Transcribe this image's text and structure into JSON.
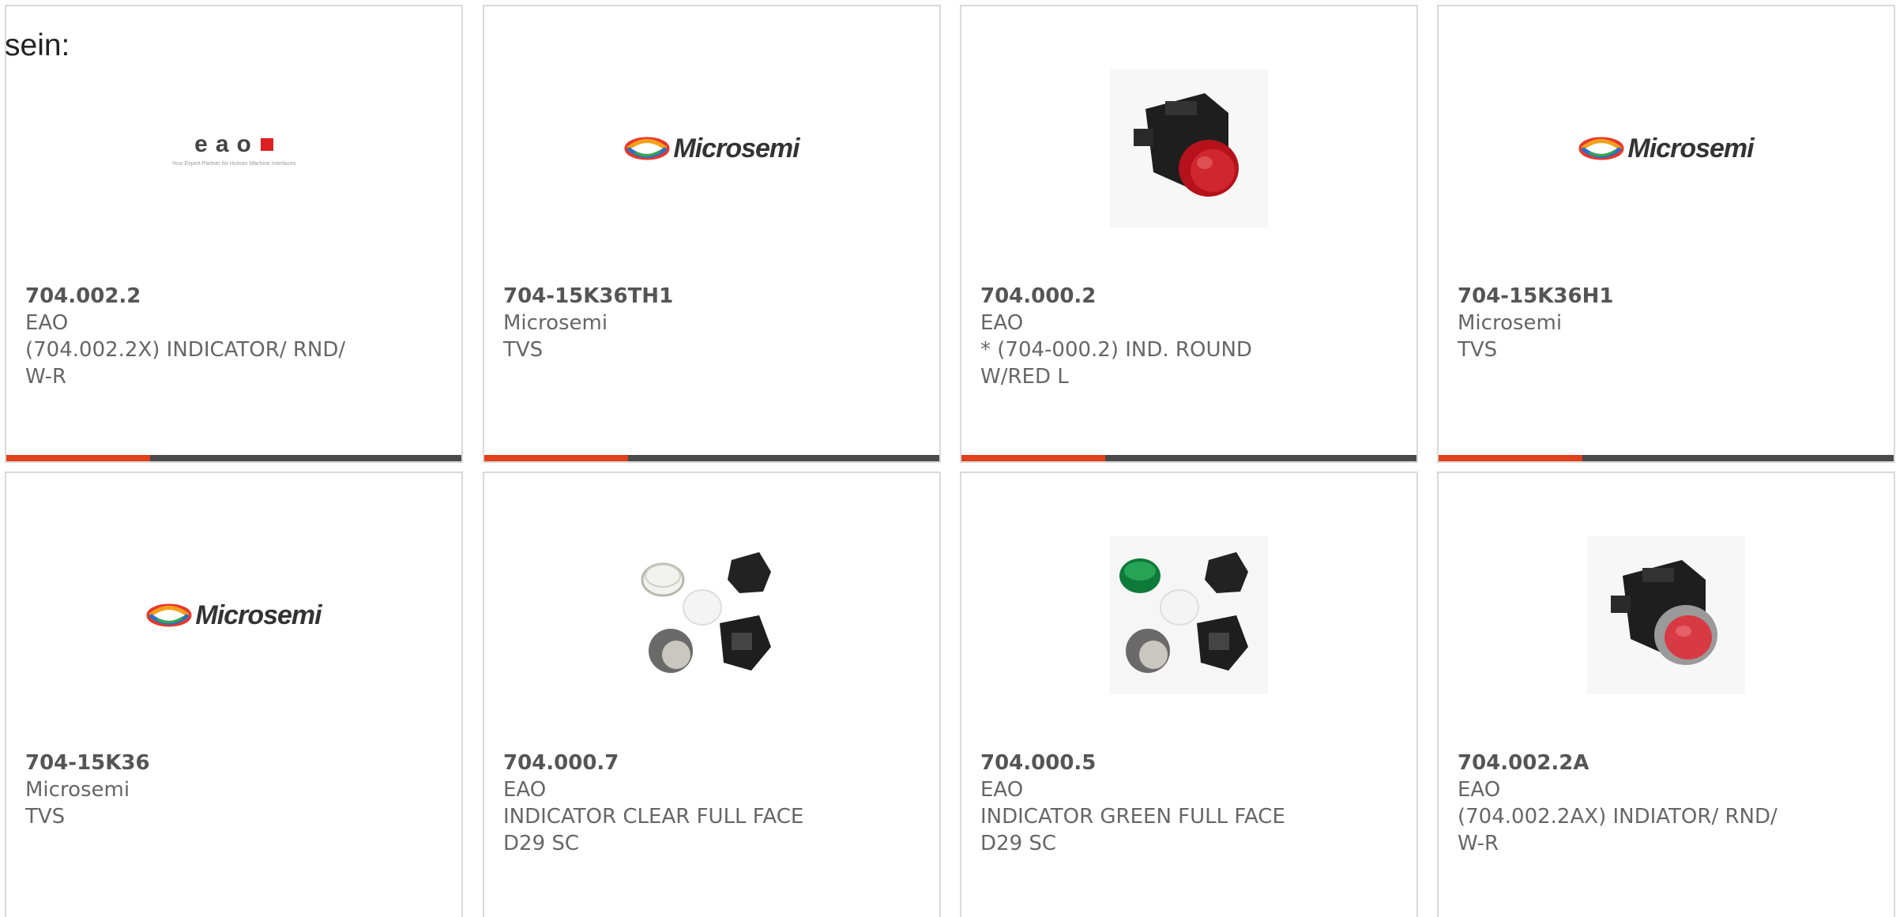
{
  "intro_text": "sein:",
  "brand_colors": {
    "accent": "#e0401a",
    "bar": "#4a4a4a",
    "border": "#d9d9d9"
  },
  "cards": [
    {
      "image": "eao-logo",
      "logo_word": "eao",
      "logo_tagline": "Your Expert Partner for Human Machine Interfaces",
      "part": "704.002.2",
      "mfr": "EAO",
      "desc": "(704.002.2X) INDICATOR/ RND/ W-R"
    },
    {
      "image": "microsemi-logo",
      "logo_word": "Microsemi",
      "part": "704-15K36TH1",
      "mfr": "Microsemi",
      "desc": "TVS"
    },
    {
      "image": "red-indicator-photo",
      "part": "704.000.2",
      "mfr": "EAO",
      "desc": "* (704-000.2) IND. ROUND W/RED L"
    },
    {
      "image": "microsemi-logo",
      "logo_word": "Microsemi",
      "part": "704-15K36H1",
      "mfr": "Microsemi",
      "desc": "TVS"
    },
    {
      "image": "microsemi-logo",
      "logo_word": "Microsemi",
      "part": "704-15K36",
      "mfr": "Microsemi",
      "desc": "TVS"
    },
    {
      "image": "clear-indicator-kit-photo",
      "part": "704.000.7",
      "mfr": "EAO",
      "desc": "INDICATOR CLEAR FULL FACE D29 SC"
    },
    {
      "image": "green-indicator-kit-photo",
      "part": "704.000.5",
      "mfr": "EAO",
      "desc": "INDICATOR GREEN FULL FACE D29 SC"
    },
    {
      "image": "red-indicator-flat-photo",
      "part": "704.002.2A",
      "mfr": "EAO",
      "desc": "(704.002.2AX) INDIATOR/ RND/ W-R"
    }
  ]
}
